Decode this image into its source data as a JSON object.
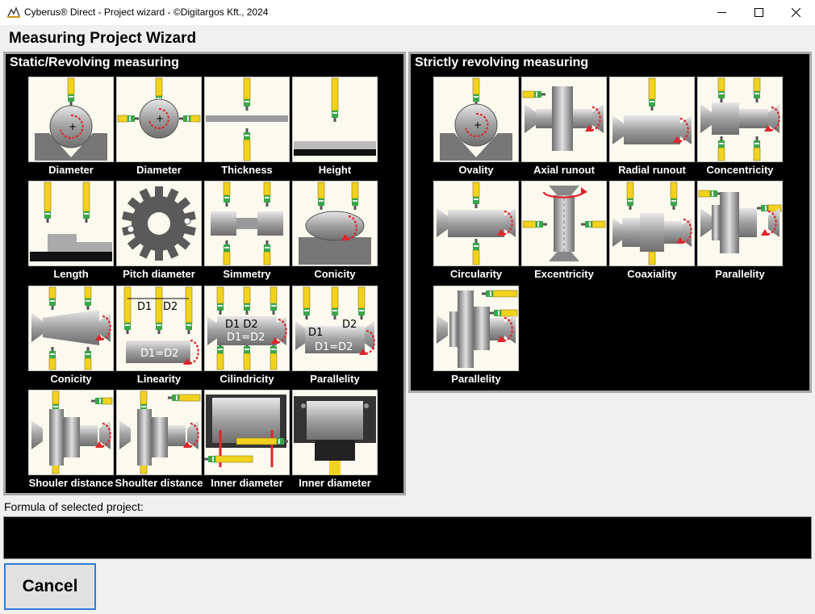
{
  "window": {
    "title": "Cyberus® Direct - Project wizard - ©Digitargos Kft., 2024",
    "icons": [
      "app-logo-icon",
      "minimize-icon",
      "maximize-icon",
      "close-icon"
    ]
  },
  "heading": "Measuring Project Wizard",
  "static_panel": {
    "title": "Static/Revolving measuring",
    "tiles": [
      {
        "label": "Diameter",
        "icon": "diameter-v-block-icon"
      },
      {
        "label": "Diameter",
        "icon": "diameter-two-probe-icon"
      },
      {
        "label": "Thickness",
        "icon": "thickness-icon"
      },
      {
        "label": "Height",
        "icon": "height-icon"
      },
      {
        "label": "Length",
        "icon": "length-step-icon"
      },
      {
        "label": "Pitch diameter",
        "icon": "gear-pitch-icon"
      },
      {
        "label": "Simmetry",
        "icon": "symmetry-icon"
      },
      {
        "label": "Conicity",
        "icon": "conicity-v-block-icon"
      },
      {
        "label": "Conicity",
        "icon": "conicity-shaft-icon"
      },
      {
        "label": "Linearity",
        "icon": "linearity-icon"
      },
      {
        "label": "Cilindricity",
        "icon": "cylindricity-icon"
      },
      {
        "label": "Parallelity",
        "icon": "parallelity-d1-d2-icon"
      },
      {
        "label": "Shouler distance",
        "icon": "shoulder-distance-left-icon"
      },
      {
        "label": "Shoulter distance",
        "icon": "shoulder-distance-right-icon"
      },
      {
        "label": "Inner diameter",
        "icon": "inner-diameter-bore-icon"
      },
      {
        "label": "Inner diameter",
        "icon": "inner-diameter-plug-icon"
      }
    ]
  },
  "revolving_panel": {
    "title": "Strictly revolving measuring",
    "tiles": [
      {
        "label": "Ovality",
        "icon": "ovality-icon"
      },
      {
        "label": "Axial runout",
        "icon": "axial-runout-icon"
      },
      {
        "label": "Radial runout",
        "icon": "radial-runout-icon"
      },
      {
        "label": "Concentricity",
        "icon": "concentricity-icon"
      },
      {
        "label": "Circularity",
        "icon": "circularity-icon"
      },
      {
        "label": "Excentricity",
        "icon": "excentricity-icon"
      },
      {
        "label": "Coaxiality",
        "icon": "coaxiality-icon"
      },
      {
        "label": "Parallelity",
        "icon": "parallelity-flange-icon"
      },
      {
        "label": "Parallelity",
        "icon": "parallelity-face-icon"
      }
    ]
  },
  "formula": {
    "label": "Formula of selected project:",
    "value": ""
  },
  "cancel_label": "Cancel",
  "colors": {
    "panel_bg": "#000000",
    "tile_bg": "#fcf9ee",
    "probe_yellow": "#f2d21e",
    "arrow_red": "#e0242a",
    "focus_border": "#2f7ad9"
  }
}
